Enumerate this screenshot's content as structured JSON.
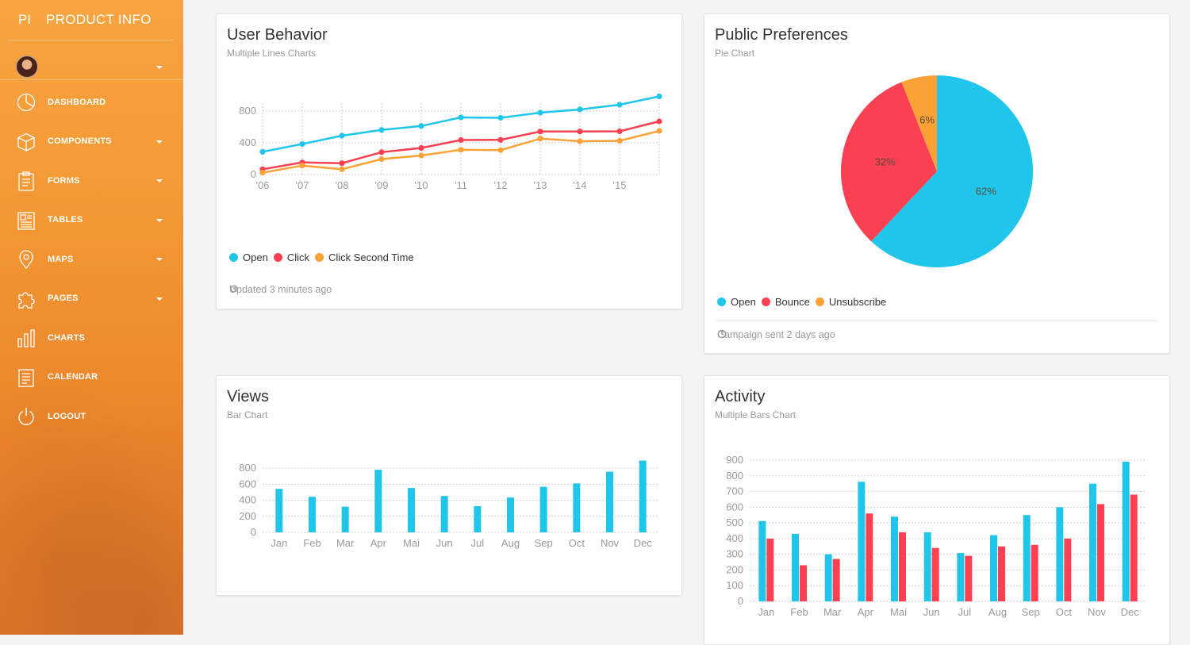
{
  "brand": {
    "mini": "PI",
    "full": "PRODUCT INFO"
  },
  "nav": [
    {
      "label": "DASHBOARD",
      "icon": "pie-chart-icon",
      "caret": false
    },
    {
      "label": "COMPONENTS",
      "icon": "cube-icon",
      "caret": true
    },
    {
      "label": "FORMS",
      "icon": "clipboard-icon",
      "caret": true
    },
    {
      "label": "TABLES",
      "icon": "table-icon",
      "caret": true
    },
    {
      "label": "MAPS",
      "icon": "map-pin-icon",
      "caret": true
    },
    {
      "label": "PAGES",
      "icon": "puzzle-icon",
      "caret": true
    },
    {
      "label": "CHARTS",
      "icon": "bar-chart-icon",
      "caret": false
    },
    {
      "label": "CALENDAR",
      "icon": "calendar-icon",
      "caret": false
    },
    {
      "label": "LOGOUT",
      "icon": "power-icon",
      "caret": false
    }
  ],
  "cards": {
    "behavior": {
      "title": "User Behavior",
      "subtitle": "Multiple Lines Charts",
      "footer": "Updated 3 minutes ago"
    },
    "preferences": {
      "title": "Public Preferences",
      "subtitle": "Pie Chart",
      "footer": "Campaign sent 2 days ago"
    },
    "views": {
      "title": "Views",
      "subtitle": "Bar Chart"
    },
    "activity": {
      "title": "Activity",
      "subtitle": "Multiple Bars Chart"
    }
  },
  "colors": {
    "cyan": "#1fc6ea",
    "red": "#fa4051",
    "orange": "#fba237"
  },
  "chart_data": [
    {
      "type": "line",
      "title": "User Behavior",
      "x": [
        "'06",
        "'07",
        "'08",
        "'09",
        "'10",
        "'11",
        "'12",
        "'13",
        "'14",
        "'15",
        ""
      ],
      "ylim": [
        0,
        900
      ],
      "yticks": [
        0,
        400,
        800
      ],
      "grid": true,
      "legend_position": "bottom-left",
      "series": [
        {
          "name": "Open",
          "color": "#1fc6ea",
          "values": [
            287,
            385,
            490,
            562,
            612,
            720,
            715,
            780,
            820,
            880,
            985
          ]
        },
        {
          "name": "Click",
          "color": "#fa4051",
          "values": [
            67,
            152,
            143,
            282,
            335,
            435,
            437,
            542,
            543,
            545,
            670
          ]
        },
        {
          "name": "Click Second Time",
          "color": "#fba237",
          "values": [
            23,
            113,
            67,
            195,
            240,
            312,
            308,
            453,
            420,
            425,
            550
          ]
        }
      ]
    },
    {
      "type": "pie",
      "title": "Public Preferences",
      "legend_position": "bottom-left",
      "slices": [
        {
          "name": "Open",
          "label": "62%",
          "value": 62,
          "color": "#1fc6ea"
        },
        {
          "name": "Bounce",
          "label": "32%",
          "value": 32,
          "color": "#fa4051"
        },
        {
          "name": "Unsubscribe",
          "label": "6%",
          "value": 6,
          "color": "#fba237"
        }
      ]
    },
    {
      "type": "bar",
      "title": "Views",
      "categories": [
        "Jan",
        "Feb",
        "Mar",
        "Apr",
        "Mai",
        "Jun",
        "Jul",
        "Aug",
        "Sep",
        "Oct",
        "Nov",
        "Dec"
      ],
      "ylim": [
        0,
        900
      ],
      "yticks": [
        0,
        200,
        400,
        600,
        800
      ],
      "grid": true,
      "series": [
        {
          "color": "#1fc6ea",
          "values": [
            542,
            443,
            320,
            780,
            553,
            453,
            326,
            434,
            568,
            610,
            756,
            895
          ]
        }
      ]
    },
    {
      "type": "bar",
      "title": "Activity",
      "categories": [
        "Jan",
        "Feb",
        "Mar",
        "Apr",
        "Mai",
        "Jun",
        "Jul",
        "Aug",
        "Sep",
        "Oct",
        "Nov",
        "Dec"
      ],
      "ylim": [
        0,
        900
      ],
      "yticks": [
        0,
        100,
        200,
        300,
        400,
        500,
        600,
        700,
        800,
        900
      ],
      "grid": true,
      "series": [
        {
          "color": "#1fc6ea",
          "values": [
            512,
            430,
            300,
            762,
            540,
            440,
            308,
            422,
            550,
            600,
            750,
            890
          ]
        },
        {
          "color": "#fa4051",
          "values": [
            400,
            230,
            270,
            560,
            440,
            340,
            290,
            350,
            360,
            400,
            620,
            680
          ]
        }
      ]
    }
  ]
}
